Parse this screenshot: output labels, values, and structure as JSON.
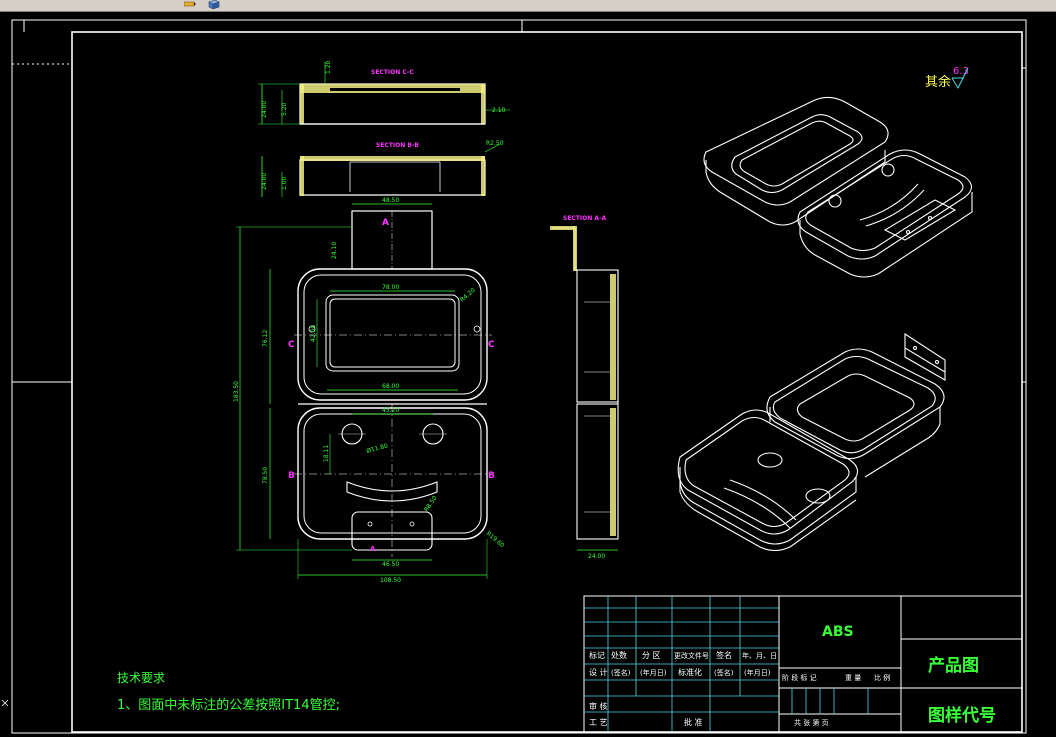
{
  "drawing": {
    "sections": {
      "c_c": "SECTION C-C",
      "b_b": "SECTION B-B",
      "a_a": "SECTION A-A"
    },
    "dims": {
      "d_120": "1.20",
      "d_2400_cc": "24.00",
      "d_520": "5.20",
      "d_210": "2.10",
      "d_r250": "R2.50",
      "d_2400_bb": "24.00",
      "d_100": "1.00",
      "d_4850": "48.50",
      "d_2410": "24.10",
      "d_7800": "78.00",
      "d_r4320": "R4.20",
      "d_7612": "76.12",
      "d_4200": "42.00",
      "d_18350": "183.50",
      "d_6800": "68.00",
      "d_4520": "45.20",
      "d_1811": "18.11",
      "d_phi1180": "Ø11.80",
      "d_7850": "78.50",
      "d_r850": "R8.50",
      "d_r1960": "R19.60",
      "d_4650": "46.50",
      "d_10850": "108.50",
      "d_2400_aa": "24.00"
    },
    "cut_letters": {
      "a_top": "A",
      "c_left": "C",
      "c_right": "C",
      "b_left": "B",
      "b_right": "B",
      "a_bottom": "A"
    },
    "surface_finish": {
      "label": "其余",
      "value": "6.3"
    },
    "tech_req": {
      "title": "技术要求",
      "line1": "1、图面中未标注的公差按照IT14管控;"
    }
  },
  "title_block": {
    "material": "ABS",
    "drawing_name": "产品图",
    "drawing_code": "图样代号",
    "row1": [
      "标记",
      "处数",
      "分 区",
      "更改文件号",
      "签名",
      "年、月、日"
    ],
    "row2": [
      "设 计",
      "(签名)",
      "(年月日)",
      "标准化",
      "(签名)",
      "(年月日)"
    ],
    "stage_labels": [
      "阶 段 标 记",
      "重 量",
      "比 例"
    ],
    "row_shen": "审 核",
    "row_gong": "工 艺",
    "pizhun": "批 准",
    "sheets": "共    张    第    页"
  },
  "colors": {
    "background": "#000000",
    "frame": "#ffffff",
    "geometry": "#ffffff",
    "hatch": "#f2ee82",
    "dimension": "#39ff39",
    "cyan": "#4fd9e8",
    "magenta": "#ff33ff",
    "yellow_text": "#ffff55"
  }
}
